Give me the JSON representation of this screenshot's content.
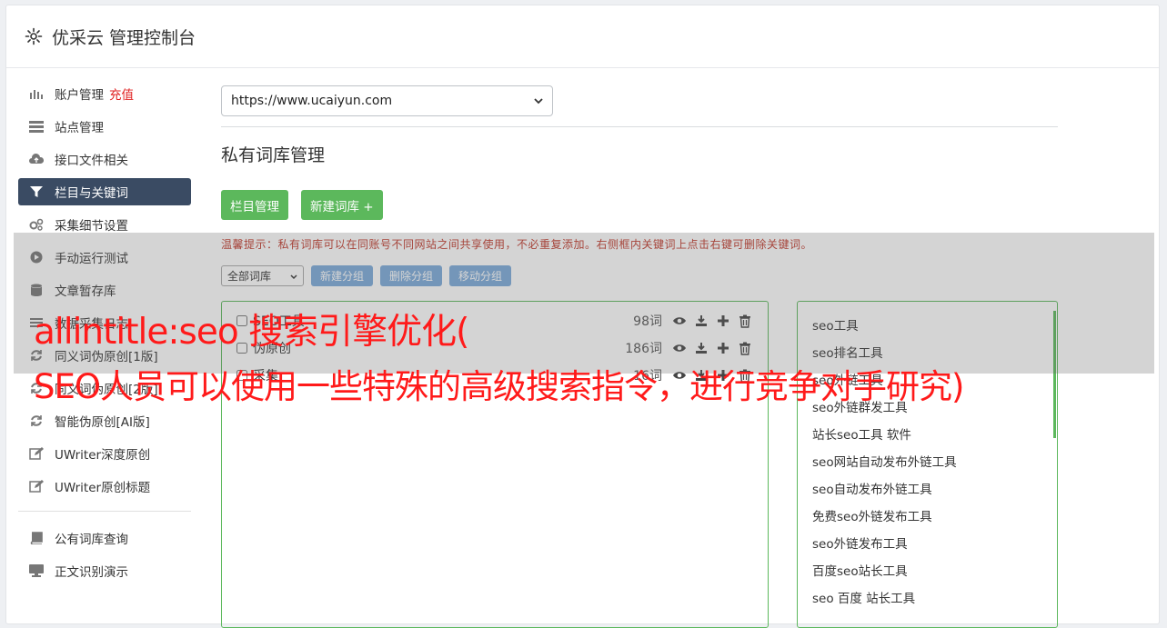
{
  "header": {
    "title": "优采云 管理控制台",
    "icon": "gear-icon"
  },
  "sidebar": {
    "items": [
      {
        "label": "账户管理",
        "badge": "充值",
        "icon": "bar-chart-icon"
      },
      {
        "label": "站点管理",
        "icon": "server-icon"
      },
      {
        "label": "接口文件相关",
        "icon": "cloud-upload-icon"
      },
      {
        "label": "栏目与关键词",
        "icon": "filter-icon",
        "active": true
      },
      {
        "label": "采集细节设置",
        "icon": "gears-icon"
      },
      {
        "label": "手动运行测试",
        "icon": "play-icon"
      },
      {
        "label": "文章暂存库",
        "icon": "database-icon"
      },
      {
        "label": "数据采集日志",
        "icon": "list-icon"
      },
      {
        "label": "同义词伪原创[1版]",
        "icon": "refresh-icon"
      },
      {
        "label": "同义词伪原创[2版]",
        "icon": "refresh-icon"
      },
      {
        "label": "智能伪原创[AI版]",
        "icon": "refresh-icon"
      },
      {
        "label": "UWriter深度原创",
        "icon": "edit-icon"
      },
      {
        "label": "UWriter原创标题",
        "icon": "edit-icon"
      },
      {
        "label": "公有词库查询",
        "icon": "book-icon"
      },
      {
        "label": "正文识别演示",
        "icon": "monitor-icon"
      }
    ]
  },
  "main": {
    "site_select": "https://www.ucaiyun.com",
    "section_title": "私有词库管理",
    "btn_columns": "栏目管理",
    "btn_new_lib": "新建词库 +",
    "tip": "温馨提示：私有词库可以在同账号不同网站之间共享使用，不必重复添加。右侧框内关键词上点击右键可删除关键词。",
    "lib_select": "全部词库",
    "btn_new_group": "新建分组",
    "btn_del_group": "删除分组",
    "btn_move_group": "移动分组",
    "libraries": [
      {
        "name": "SEO工具",
        "count": "98词"
      },
      {
        "name": "伪原创",
        "count": "186词"
      },
      {
        "name": "采集",
        "count": "16词"
      }
    ],
    "keywords": [
      "seo工具",
      "seo排名工具",
      "seo外链工具",
      "seo外链群发工具",
      "站长seo工具 软件",
      "seo网站自动发布外链工具",
      "seo自动发布外链工具",
      "免费seo外链发布工具",
      "seo外链发布工具",
      "百度seo站长工具",
      "seo 百度 站长工具"
    ]
  },
  "overlay": {
    "line1": "allintitle:seo 搜索引擎优化(",
    "line2": "SEO人员可以使用一些特殊的高级搜索指令，进行竞争对手研究)"
  },
  "colors": {
    "active_nav": "#3a4b63",
    "green": "#5cb85c",
    "blue_btn": "#7aa9da",
    "overlay_text": "#ff1a1a",
    "recharge": "#e02020"
  }
}
